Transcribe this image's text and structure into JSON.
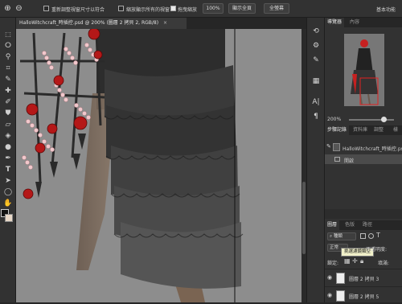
{
  "options_bar": {
    "zoom_icon_a": "zoom-in-icon",
    "zoom_icon_b": "zoom-out-icon",
    "resize_windows_label": "重新調整視窗尺寸以符合",
    "zoom_all_windows_label": "縮放顯示所有的視窗",
    "scrubby_zoom_label": "拖曳縮放",
    "zoom_percent": "100%",
    "fit_screen_label": "顯示全頁",
    "fill_screen_label": "全螢幕",
    "workspace_label": "基本功能"
  },
  "document": {
    "tab_title": "HalloWitchcraft_時插控.psd @ 200% (圖層 2 拷貝 2, RGB/8)",
    "close_glyph": "×"
  },
  "panels": {
    "top_tabs": [
      "導覽器",
      "內容"
    ],
    "navigator_zoom": "200%",
    "history_tabs": [
      "步驟記錄",
      "資料庫",
      "調整",
      "樣"
    ],
    "history_items": [
      {
        "label": "HalloWitchcraft_時插控.psd",
        "type": "snapshot"
      },
      {
        "label": "開啟",
        "type": "step"
      }
    ],
    "layer_tabs": [
      "圖層",
      "色版",
      "路徑"
    ],
    "kind_label": "種類",
    "blend_mode": "正常",
    "opacity_label": "不透明度:",
    "opacity_value": "",
    "lock_label": "鎖定:",
    "fill_label": "填滿:",
    "tooltip": "挑選濾鏡類型",
    "layers": [
      "圖層 2 拷貝 3",
      "圖層 2 拷貝 5"
    ]
  },
  "colors": {
    "accent_red": "#c62020",
    "ui_dark": "#323232",
    "canvas_gray": "#888888"
  }
}
